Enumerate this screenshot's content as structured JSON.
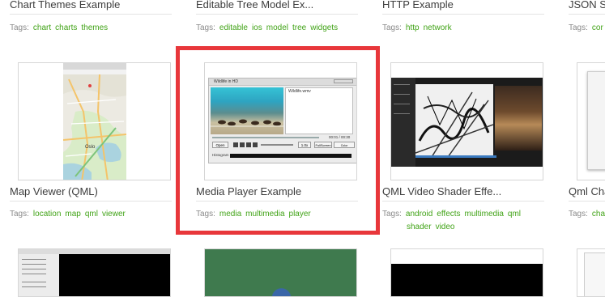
{
  "cards": [
    {
      "title": "Chart Themes Example",
      "tags_label": "Tags:",
      "tags": [
        "chart",
        "charts",
        "themes"
      ]
    },
    {
      "title": "Editable Tree Model Ex...",
      "tags_label": "Tags:",
      "tags": [
        "editable",
        "ios",
        "model",
        "tree",
        "widgets"
      ]
    },
    {
      "title": "HTTP Example",
      "tags_label": "Tags:",
      "tags": [
        "http",
        "network"
      ]
    },
    {
      "title": "JSON Sa",
      "tags_label": "Tags:",
      "tags": [
        "cor"
      ]
    },
    {
      "title": "Map Viewer (QML)",
      "tags_label": "Tags:",
      "tags": [
        "location",
        "map",
        "qml",
        "viewer"
      ],
      "thumb_text": {
        "city": "Oslo"
      }
    },
    {
      "title": "Media Player Example",
      "tags_label": "Tags:",
      "tags": [
        "media",
        "multimedia",
        "player"
      ],
      "thumb_text": {
        "window_title": "Wildlife in HD",
        "file": "Wildlife.wmv",
        "time": "00:01 / 00:30",
        "open": "Open",
        "fullscreen": "FullScreen",
        "color_options": "Color Options...",
        "rate": "1.0x",
        "histogram": "Histogram"
      }
    },
    {
      "title": "QML Video Shader Effe...",
      "tags_label": "Tags:",
      "tags": [
        "android",
        "effects",
        "multimedia",
        "qml",
        "shader",
        "video"
      ]
    },
    {
      "title": "Qml Cha",
      "tags_label": "Tags:",
      "tags": [
        "cha"
      ]
    }
  ],
  "highlight_color": "#e8373b",
  "tag_color": "#41a317"
}
